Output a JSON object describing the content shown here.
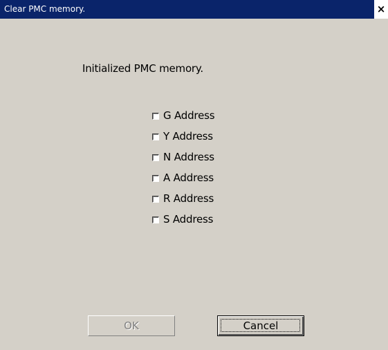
{
  "window": {
    "title": "Clear PMC memory.",
    "close_glyph": "×"
  },
  "content": {
    "heading": "Initialized PMC memory.",
    "checkboxes": [
      {
        "label": "G Address",
        "checked": false
      },
      {
        "label": "Y Address",
        "checked": false
      },
      {
        "label": "N Address",
        "checked": false
      },
      {
        "label": "A Address",
        "checked": false
      },
      {
        "label": "R Address",
        "checked": false
      },
      {
        "label": "S Address",
        "checked": false
      }
    ]
  },
  "buttons": {
    "ok_label": "OK",
    "ok_enabled": false,
    "cancel_label": "Cancel"
  },
  "colors": {
    "titlebar": "#0a246a",
    "dialog_face": "#d4d0c8",
    "disabled_text": "#808080"
  }
}
